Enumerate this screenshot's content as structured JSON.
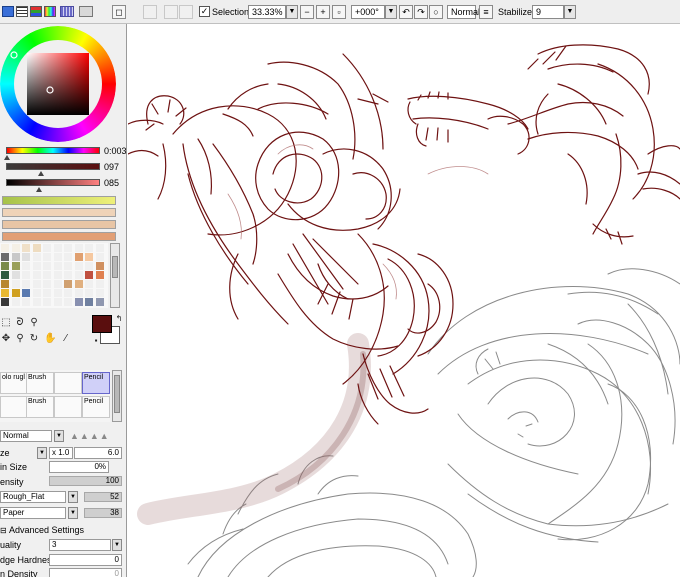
{
  "toolbar": {
    "selection_label": "Selection",
    "selection_checked": "✓",
    "zoom": "33.33%",
    "rotation": "+000°",
    "blend_mode": "Normal",
    "stabilizer_label": "Stabilizer",
    "stabilizer_value": "9"
  },
  "color_panel": {
    "selected_color": "#5a0e0e",
    "slider_values": [
      "0:003",
      "097",
      "085"
    ]
  },
  "palette_colors": [
    "#a6c24a",
    "#efd3b8",
    "#e8c5a5",
    "#e29f75",
    "#e7bda0"
  ],
  "swatch_grid": [
    "#f5f0e6",
    "#f5f0e6",
    "#f0e0c8",
    "#eedcc0",
    "#f0f0f0",
    "#f0f0f0",
    "#f0f0f0",
    "#f0f0f0",
    "#f0f0f0",
    "#f0f0f0",
    "#6b6b6b",
    "#c8c8c8",
    "#e0e0e0",
    "#f0f0f0",
    "#f0f0f0",
    "#f0f0f0",
    "#f0f0f0",
    "#e0a070",
    "#f5c8a0",
    "#f0f0f0",
    "#7a8a4a",
    "#9aa05a",
    "#f0f0f0",
    "#f0f0f0",
    "#f0f0f0",
    "#f0f0f0",
    "#f0f0f0",
    "#f0f0f0",
    "#f0f0f0",
    "#d09060",
    "#2d5a40",
    "#e0e0e0",
    "#f0f0f0",
    "#f0f0f0",
    "#f0f0f0",
    "#f0f0f0",
    "#f0f0f0",
    "#f0f0f0",
    "#c05040",
    "#e08050",
    "#b88830",
    "#f0f0f0",
    "#f0f0f0",
    "#f0f0f0",
    "#f0f0f0",
    "#f0f0f0",
    "#d0a070",
    "#e0b080",
    "#f0f0f0",
    "#f0f0f0",
    "#e8b830",
    "#d0a020",
    "#5a7ab0",
    "#f0f0f0",
    "#f0f0f0",
    "#f0f0f0",
    "#f0f0f0",
    "#f0f0f0",
    "#f0f0f0",
    "#f0f0f0",
    "#383838",
    "#f0f0f0",
    "#f0f0f0",
    "#f0f0f0",
    "#f0f0f0",
    "#f0f0f0",
    "#f0f0f0",
    "#8890b0",
    "#7080a0",
    "#9098b0"
  ],
  "brushes": [
    {
      "label": "olo rugl"
    },
    {
      "label": "Brush"
    },
    {
      "label": "Brush"
    },
    {
      "label": "Pencil"
    },
    {
      "label": "Pencil"
    },
    {
      "label": "Brush"
    }
  ],
  "tool_panel": {
    "blend_mode": "Normal",
    "size_label": "ze",
    "size_mult": "x 1.0",
    "size_value": "6.0",
    "min_size_label": "in Size",
    "min_size_value": "0%",
    "density_label": "ensity",
    "density_value": "100",
    "shape_name": "Rough_Flat",
    "shape_value": "52",
    "texture_name": "Paper",
    "texture_value": "38",
    "advanced_label": "Advanced Settings",
    "quality_label": "uality",
    "quality_value": "3",
    "edge_label": "dge Hardness",
    "edge_value": "0",
    "min_density_label": "n Density",
    "min_density_value": "0"
  }
}
